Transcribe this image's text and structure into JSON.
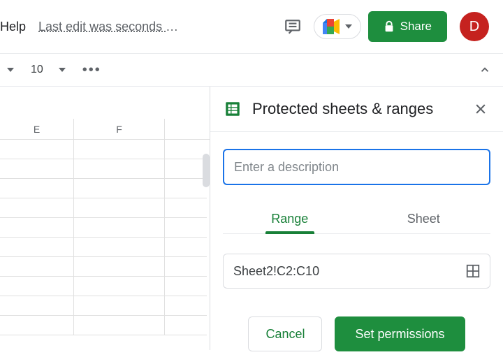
{
  "header": {
    "menu_help": "Help",
    "last_edit": "Last edit was seconds ago",
    "share_label": "Share",
    "avatar_initial": "D"
  },
  "toolbar": {
    "font_size": "10"
  },
  "columns": [
    "E",
    "F"
  ],
  "sidepanel": {
    "title": "Protected sheets & ranges",
    "description_placeholder": "Enter a description",
    "description_value": "",
    "tabs": {
      "range": "Range",
      "sheet": "Sheet"
    },
    "active_tab": "range",
    "range_value": "Sheet2!C2:C10",
    "cancel_label": "Cancel",
    "set_permissions_label": "Set permissions"
  }
}
